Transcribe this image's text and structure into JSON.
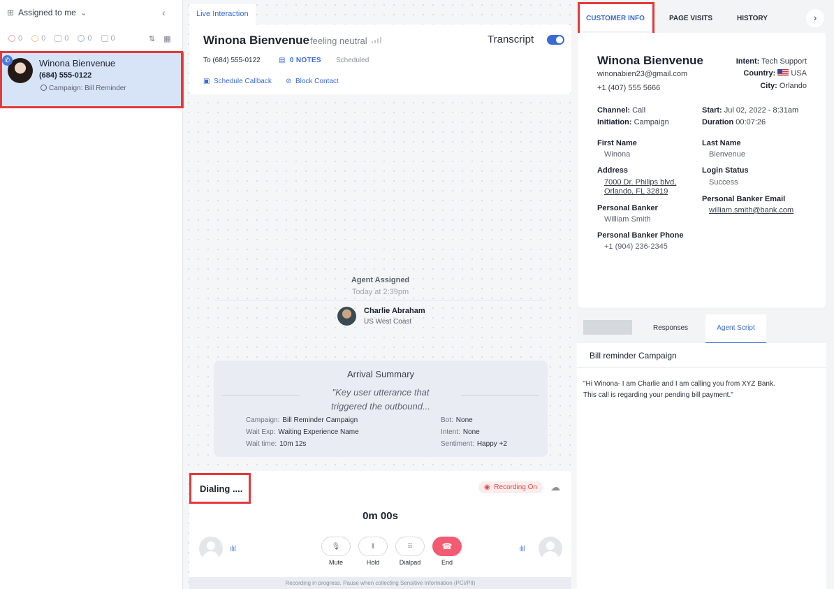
{
  "left": {
    "filter_label": "Assigned to me",
    "counters": [
      {
        "value": "0",
        "color": "#f0a0a0"
      },
      {
        "value": "0",
        "color": "#f3c580"
      },
      {
        "value": "0",
        "color": "#a0a5ae"
      },
      {
        "value": "0",
        "color": "#9cb5ea"
      },
      {
        "value": "0",
        "color": "#a0a5ae"
      }
    ],
    "conversation": {
      "name": "Winona Bienvenue",
      "phone": "(684) 555-0122",
      "campaign": "Campaign: Bill Reminder"
    }
  },
  "center": {
    "tab": "Live Interaction",
    "customer_name": "Winona Bienvenue",
    "sentiment": "feeling neutral",
    "transcript_label": "Transcript",
    "to_phone": "To (684) 555-0122",
    "notes": "0 NOTES",
    "status": "Scheduled",
    "schedule_callback": "Schedule Callback",
    "block_contact": "Block Contact",
    "agent_assigned": {
      "title": "Agent Assigned",
      "time": "Today at 2:39pm",
      "agent_name": "Charlie Abraham",
      "agent_location": "US West Coast"
    },
    "arrival": {
      "title": "Arrival Summary",
      "quote_line1": "\"Key user utterance that",
      "quote_line2": "triggered the outbound...",
      "campaign_label": "Campaign:",
      "campaign_value": "Bill Reminder Campaign",
      "wait_exp_label": "Wait Exp:",
      "wait_exp_value": "Waiting Experience Name",
      "wait_time_label": "Wait time:",
      "wait_time_value": "10m 12s",
      "bot_label": "Bot:",
      "bot_value": "None",
      "intent_label": "Intent:",
      "intent_value": "None",
      "sentiment_label": "Sentiment:",
      "sentiment_value": "Happy +2"
    },
    "call": {
      "status": "Dialing ....",
      "recording": "Recording On",
      "timer": "0m 00s",
      "controls": [
        "Mute",
        "Hold",
        "Dialpad",
        "End"
      ],
      "footer": "Recording in progress. Pause when collecting Sensitive Information (PCI/PII)"
    }
  },
  "right": {
    "tabs": [
      "CUSTOMER INFO",
      "PAGE VISITS",
      "HISTORY"
    ],
    "customer": {
      "name": "Winona Bienvenue",
      "email": "winonabien23@gmail.com",
      "phone": "+1 (407) 555 5666",
      "intent_label": "Intent:",
      "intent_value": "Tech Support",
      "country_label": "Country:",
      "country_value": "USA",
      "city_label": "City:",
      "city_value": "Orlando",
      "channel_label": "Channel:",
      "channel_value": "Call",
      "initiation_label": "Initiation:",
      "initiation_value": "Campaign",
      "start_label": "Start:",
      "start_value": "Jul 02, 2022 - 8:31am",
      "duration_label": "Duration",
      "duration_value": "00:07:26",
      "first_name_label": "First Name",
      "first_name": "Winona",
      "last_name_label": "Last Name",
      "last_name": "Bienvenue",
      "address_label": "Address",
      "address_line1": "7000 Dr. Philips blvd,",
      "address_line2": "Orlando, FL 32819",
      "login_status_label": "Login Status",
      "login_status": "Success",
      "banker_label": "Personal Banker",
      "banker": "William Smith",
      "banker_email_label": "Personal Banker Email",
      "banker_email": "william.smith@bank.com",
      "banker_phone_label": "Personal Banker Phone",
      "banker_phone": "+1 (904) 236-2345"
    },
    "bottom_tabs": [
      "Responses",
      "Agent Script"
    ],
    "script_title": "Bill reminder Campaign",
    "script_line1": "\"Hi Winona- I am Charlie and I am calling you from XYZ Bank.",
    "script_line2": "This call is regarding your pending bill payment.\""
  }
}
